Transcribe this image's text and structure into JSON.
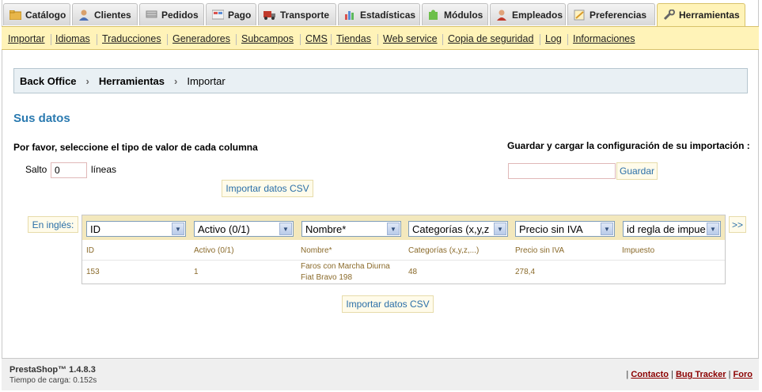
{
  "tabs": [
    {
      "label": "Catálogo",
      "icon": "folder-icon"
    },
    {
      "label": "Clientes",
      "icon": "user-icon"
    },
    {
      "label": "Pedidos",
      "icon": "cart-icon"
    },
    {
      "label": "Pago",
      "icon": "payment-icon"
    },
    {
      "label": "Transporte",
      "icon": "truck-icon"
    },
    {
      "label": "Estadísticas",
      "icon": "chart-icon"
    },
    {
      "label": "Módulos",
      "icon": "puzzle-icon"
    },
    {
      "label": "Empleados",
      "icon": "employee-icon"
    },
    {
      "label": "Preferencias",
      "icon": "preferences-icon"
    },
    {
      "label": "Herramientas",
      "icon": "wrench-icon",
      "active": true
    }
  ],
  "submenu": [
    "Importar",
    "Idiomas",
    "Traducciones",
    "Generadores",
    "Subcampos",
    "CMS",
    "Tiendas",
    "Web service",
    "Copia de seguridad",
    "Log",
    "Informaciones"
  ],
  "breadcrumb": {
    "root": "Back Office",
    "section": "Herramientas",
    "current": "Importar"
  },
  "main": {
    "title": "Sus datos",
    "instruction": "Por favor, seleccione el tipo de valor de cada columna",
    "save_config_label": "Guardar y cargar la configuración de su importación :",
    "skip_label": "Salto",
    "skip_value": "0",
    "lines_label": "líneas",
    "save_button": "Guardar",
    "save_input_value": "",
    "import_button": "Importar datos CSV",
    "lang_button": "En inglés:",
    "next_button": ">>"
  },
  "table": {
    "selects": [
      "ID",
      "Activo (0/1)",
      "Nombre*",
      "Categorías (x,y,z",
      "Precio sin IVA",
      "id regla de impue"
    ],
    "headers": [
      "ID",
      "Activo (0/1)",
      "Nombre*",
      "Categorías (x,y,z,...)",
      "Precio sin IVA",
      "Impuesto"
    ],
    "row": [
      "153",
      "1",
      "Faros con Marcha Diurna",
      "48",
      "278,4",
      ""
    ],
    "row_line2": "Fiat Bravo 198"
  },
  "footer": {
    "version": "PrestaShop™ 1.4.8.3",
    "load_time": "Tiempo de carga: 0.152s",
    "links": [
      "Contacto",
      "Bug Tracker",
      "Foro"
    ]
  },
  "colors": {
    "accent": "#2a7ab0",
    "tab_active": "#fff3b8",
    "header_row": "#f3e8bd"
  }
}
